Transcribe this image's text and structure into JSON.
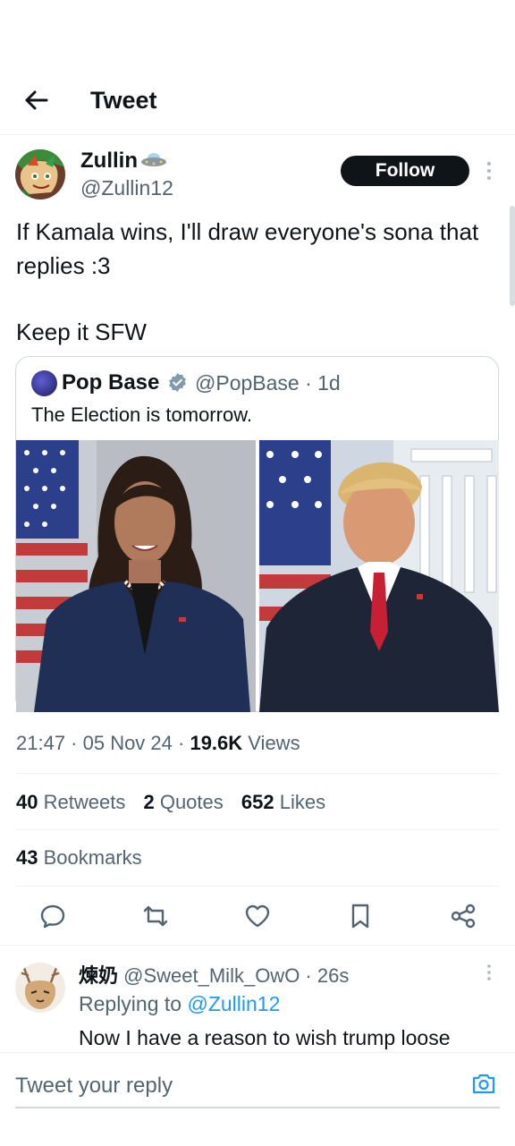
{
  "header": {
    "title": "Tweet",
    "back_icon": "arrow-left-icon"
  },
  "tweet": {
    "author_name": "Zullin",
    "author_handle": "@Zullin12",
    "follow_label": "Follow",
    "body_line1": "If Kamala wins, I'll draw everyone's sona that replies :3",
    "body_line2": "Keep it SFW",
    "timestamp": "21:47 · 05 Nov 24 · ",
    "views_count": "19.6K",
    "views_label": " Views",
    "retweets_count": "40",
    "retweets_label": "Retweets",
    "quotes_count": "2",
    "quotes_label": "Quotes",
    "likes_count": "652",
    "likes_label": "Likes",
    "bookmarks_count": "43",
    "bookmarks_label": "Bookmarks"
  },
  "quote": {
    "author_name": "Pop Base",
    "author_handle": "@PopBase",
    "time": " · 1d",
    "text": "The Election is tomorrow."
  },
  "actions": [
    "reply-icon",
    "retweet-icon",
    "like-icon",
    "bookmark-icon",
    "share-icon"
  ],
  "reply": {
    "author_name": "煉奶",
    "author_handle": "@Sweet_Milk_OwO",
    "time": " · 26s",
    "replying_prefix": "Replying to ",
    "replying_handle": "@Zullin12",
    "text": "Now I have a reason to wish trump loose"
  },
  "composer": {
    "placeholder": "Tweet your reply"
  },
  "colors": {
    "link": "#1d9bf0",
    "muted": "#536471",
    "text": "#0f1419",
    "verified": "#829aab"
  }
}
